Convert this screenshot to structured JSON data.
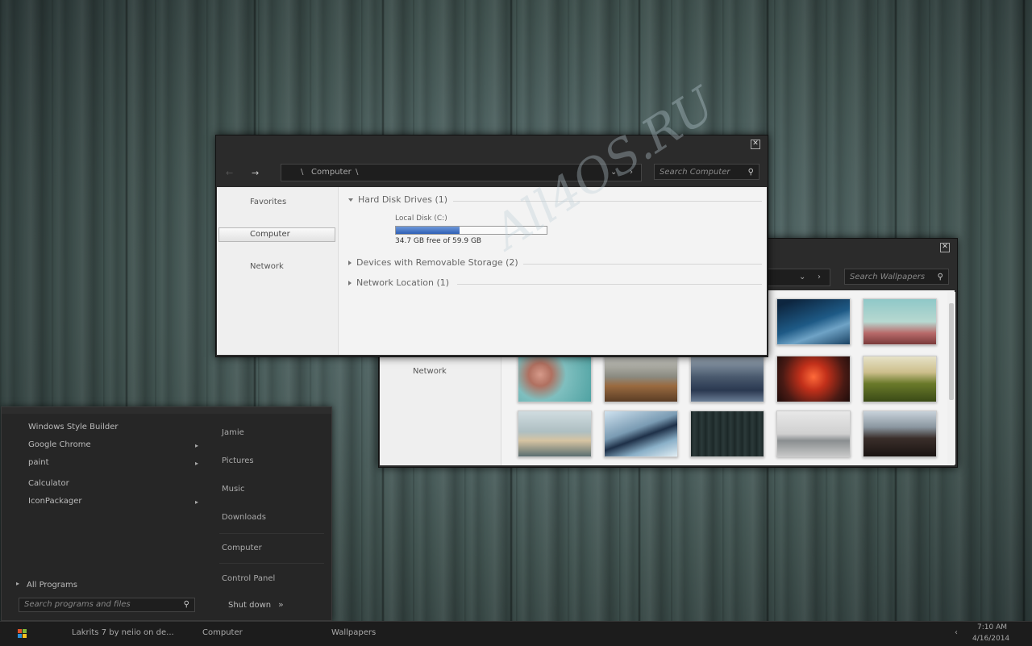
{
  "watermark": "All4OS.RU",
  "computer_window": {
    "address_sep": "\\",
    "address_location": "Computer",
    "search_placeholder": "Search Computer",
    "nav": {
      "favorites": "Favorites",
      "computer": "Computer",
      "network": "Network"
    },
    "groups": {
      "hard_disk": "Hard Disk Drives (1)",
      "removable": "Devices with Removable Storage (2)",
      "network_location": "Network Location (1)"
    },
    "drive": {
      "name": "Local Disk (C:)",
      "free_text": "34.7 GB free of 59.9 GB",
      "used_fraction": 0.42
    }
  },
  "wallpapers_window": {
    "search_placeholder": "Search Wallpapers",
    "nav_network": "Network"
  },
  "start_menu": {
    "programs": [
      "Windows Style Builder",
      "Google Chrome",
      "paint",
      "Calculator",
      "IconPackager"
    ],
    "all_programs": "All Programs",
    "search_placeholder": "Search programs and files",
    "places": [
      "Jamie",
      "Pictures",
      "Music",
      "Downloads",
      "Computer",
      "Control Panel"
    ],
    "shutdown": "Shut down"
  },
  "taskbar": {
    "items": [
      "Lakrits 7 by neiio on de...",
      "Computer",
      "Wallpapers"
    ],
    "time": "7:10 AM",
    "date": "4/16/2014"
  }
}
